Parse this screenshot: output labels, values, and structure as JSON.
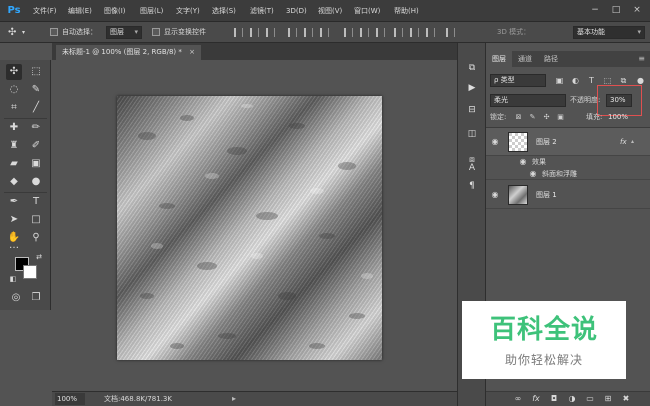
{
  "app": {
    "logo_text": "Ps"
  },
  "menu": {
    "items": [
      "文件(F)",
      "编辑(E)",
      "图像(I)",
      "图层(L)",
      "文字(Y)",
      "选择(S)",
      "滤镜(T)",
      "3D(D)",
      "视图(V)",
      "窗口(W)",
      "帮助(H)"
    ]
  },
  "window_controls": {
    "minimize": "−",
    "restore": "□",
    "close": "×"
  },
  "options_bar": {
    "auto_select_label": "自动选择：",
    "auto_select_value": "图层",
    "show_transform_label": "显示变换控件",
    "mode_3d_label": "3D 模式：",
    "workspace_value": "基本功能"
  },
  "document": {
    "tab_title": "未标题-1 @ 100% (图层 2, RGB/8) *",
    "close_glyph": "×"
  },
  "status": {
    "zoom": "100%",
    "doc_info": "文档:468.8K/781.3K",
    "arrow": "▸"
  },
  "layers_panel": {
    "tabs": [
      "图层",
      "通道",
      "路径"
    ],
    "menu_glyph": "≡",
    "filter_kind": "ρ 类型",
    "blend_mode": "柔光",
    "opacity_label": "不透明度:",
    "opacity_value": "30%",
    "lock_label": "锁定:",
    "fill_label": "填充:",
    "fill_value": "100%",
    "layers": [
      {
        "name": "图层 2",
        "fx": "fx",
        "thumb": "checker",
        "selected": true
      },
      {
        "name": "图层 1",
        "thumb": "metal",
        "selected": false
      }
    ],
    "effects_header": "效果",
    "effect_item": "斜面和浮雕"
  },
  "watermark": {
    "title": "百科全说",
    "subtitle": "助你轻松解决",
    "color": "#3ec27a"
  },
  "icons": {
    "move": "move-icon",
    "marquee": "marquee-icon",
    "lasso": "lasso-icon",
    "quick_select": "quick-select-icon",
    "crop": "crop-icon",
    "eyedropper": "eyedropper-icon",
    "healing": "healing-brush-icon",
    "brush": "brush-icon",
    "stamp": "clone-stamp-icon",
    "history_brush": "history-brush-icon",
    "eraser": "eraser-icon",
    "gradient": "gradient-icon",
    "blur": "blur-icon",
    "dodge": "dodge-icon",
    "pen": "pen-icon",
    "type": "type-icon",
    "path_select": "path-selection-icon",
    "shape": "rectangle-shape-icon",
    "hand": "hand-icon",
    "zoom": "zoom-icon"
  }
}
